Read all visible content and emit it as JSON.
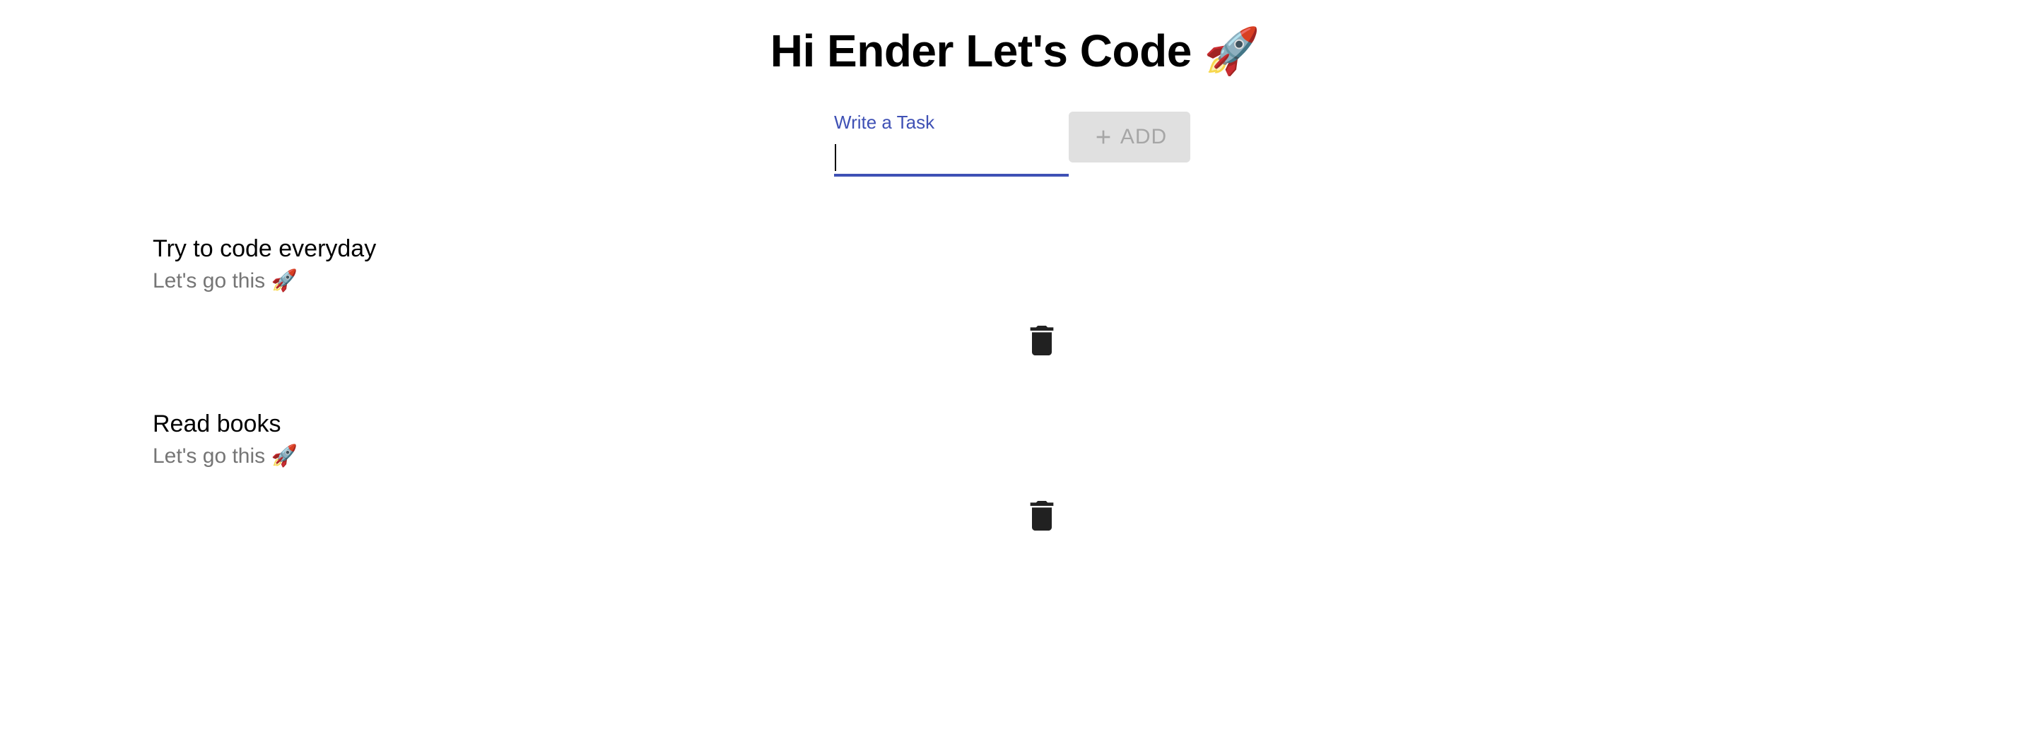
{
  "header": {
    "title": "Hi Ender Let's Code 🚀"
  },
  "task_input": {
    "label": "Write a Task",
    "value": ""
  },
  "add_button": {
    "label": "ADD",
    "icon": "plus-icon"
  },
  "tasks": [
    {
      "title": "Try to code everyday",
      "subtitle": "Let's go this 🚀",
      "action_icon": "trash-icon"
    },
    {
      "title": "Read books",
      "subtitle": "Let's go this 🚀",
      "action_icon": "trash-icon"
    }
  ],
  "colors": {
    "accent": "#3f51b5",
    "button_bg": "#e0e0e0",
    "button_text": "#a6a6a6",
    "secondary_text": "#757575"
  }
}
